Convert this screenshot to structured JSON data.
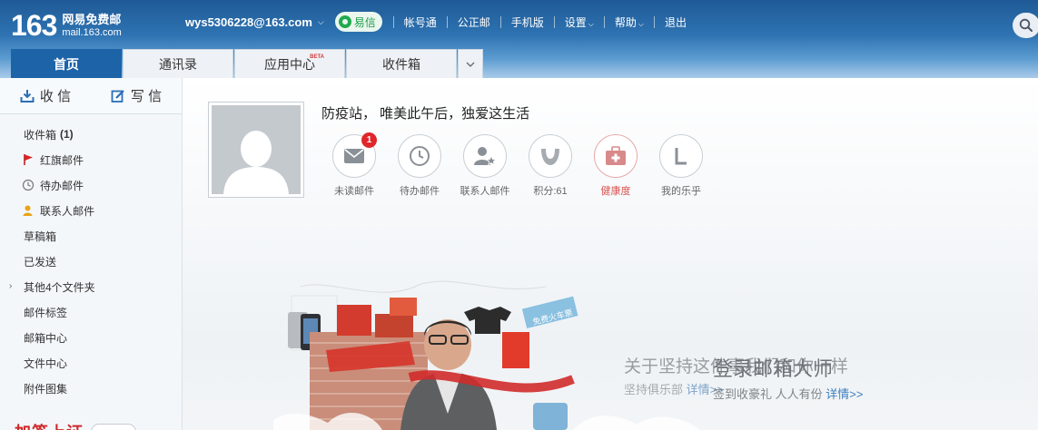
{
  "header": {
    "logo_number": "163",
    "logo_title": "网易免费邮",
    "logo_domain": "mail.163.com",
    "user_email": "wys5306228@163.com",
    "yixin_label": "易信",
    "links": [
      "帐号通",
      "公正邮",
      "手机版",
      "设置",
      "帮助",
      "退出"
    ],
    "search_icon": "search-icon"
  },
  "tabs": [
    "首页",
    "通讯录",
    "应用中心",
    "收件箱"
  ],
  "tab_beta": "BETA",
  "sidebar": {
    "receive_label": "收 信",
    "write_label": "写 信",
    "items": [
      {
        "label": "收件箱",
        "count": "(1)"
      },
      {
        "label": "红旗邮件",
        "icon": "flag-icon"
      },
      {
        "label": "待办邮件",
        "icon": "clock-icon"
      },
      {
        "label": "联系人邮件",
        "icon": "contact-icon"
      },
      {
        "label": "草稿箱"
      },
      {
        "label": "已发送"
      },
      {
        "label": "其他4个文件夹",
        "expandable": true
      },
      {
        "label": "邮件标签"
      },
      {
        "label": "邮箱中心"
      },
      {
        "label": "文件中心"
      },
      {
        "label": "附件图集"
      }
    ],
    "promo_text": "加签上证"
  },
  "main": {
    "motto": "防疫站， 唯美此午后，独爱这生活",
    "unread_badge": "1",
    "quick": [
      {
        "label": "未读邮件",
        "icon": "mail-icon"
      },
      {
        "label": "待办邮件",
        "icon": "clock-icon"
      },
      {
        "label": "联系人邮件",
        "icon": "contact-star-icon"
      },
      {
        "label": "积分:61",
        "icon": "points-icon"
      },
      {
        "label": "健康度",
        "icon": "health-kit-icon"
      },
      {
        "label": "我的乐乎",
        "icon": "lofter-icon"
      }
    ],
    "banner": {
      "slogan_faded": "关于坚持这件事我们和你一样",
      "slogan_faded_sub": "坚持俱乐部",
      "slogan_faded_link": "详情>>",
      "slogan": "登录邮箱大师",
      "slogan_sub": "签到收豪礼 人人有份",
      "slogan_link": "详情>>",
      "tag_text": "免费火车票"
    }
  },
  "colors": {
    "header_blue": "#2e73b2",
    "tab_active": "#1c63a8",
    "badge_red": "#e0262a",
    "yixin_green": "#22a94f"
  }
}
